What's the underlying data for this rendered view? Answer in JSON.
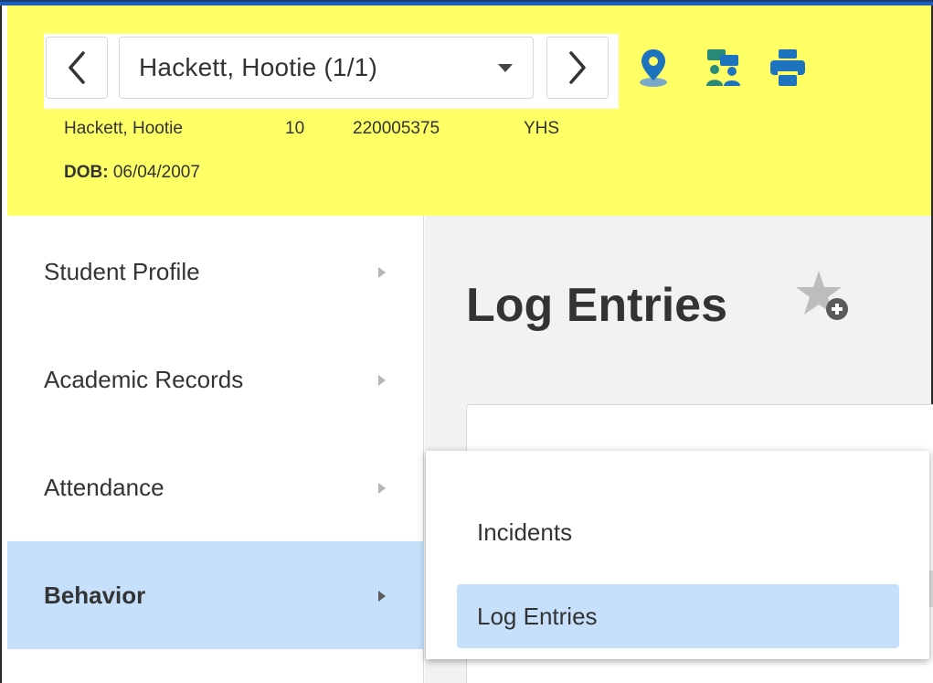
{
  "header": {
    "student_selector": {
      "label": "Hackett, Hootie  (1/1)"
    },
    "icons": [
      "location-pin-icon",
      "conversation-icon",
      "printer-icon"
    ],
    "student_info": {
      "name": "Hackett, Hootie",
      "grade": "10",
      "student_id": "220005375",
      "school": "YHS",
      "dob_label": "DOB:",
      "dob_value": "06/04/2007"
    },
    "background_color": "#ffff66"
  },
  "sidebar": {
    "items": [
      {
        "label": "Student Profile",
        "active": false
      },
      {
        "label": "Academic Records",
        "active": false
      },
      {
        "label": "Attendance",
        "active": false
      },
      {
        "label": "Behavior",
        "active": true
      }
    ]
  },
  "main": {
    "title": "Log Entries"
  },
  "flyout": {
    "items": [
      {
        "label": "Incidents",
        "active": false
      },
      {
        "label": "Log Entries",
        "active": true
      }
    ]
  },
  "colors": {
    "accent": "#1e73be",
    "active_bg": "#c6e0fb"
  }
}
